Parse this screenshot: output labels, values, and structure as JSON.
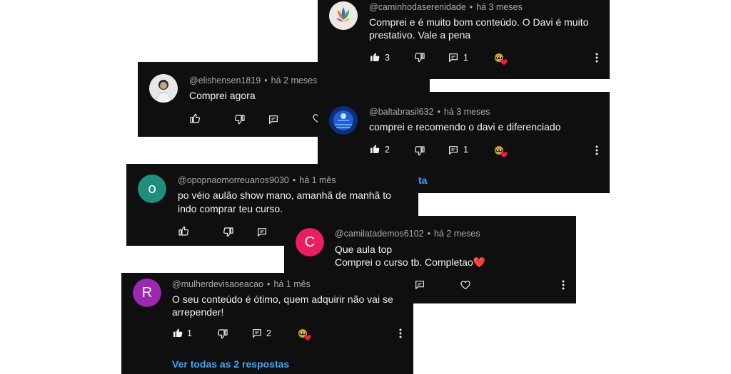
{
  "comments": [
    {
      "handle": "@caminhodaserenidade",
      "time": "há 3 meses",
      "line1": "Comprei e é muito bom conteúdo. O Davi é muito",
      "line2": "prestativo. Vale a pena",
      "likes": "3",
      "replies": "1"
    },
    {
      "handle": "@elishensen1819",
      "time": "há 2 meses",
      "line1": "Comprei agora"
    },
    {
      "handle": "@baltabrasil632",
      "time": "há 3 meses",
      "line1": "comprei e recomendo o davi e diferenciado",
      "likes": "2",
      "replies": "1",
      "partial_link": "ta"
    },
    {
      "handle": "@opopnaomorreuanos9030",
      "time": "há 1 mês",
      "line1": "po véio aulão show mano, amanhã de manhã to",
      "line2": "indo comprar teu curso.",
      "avatar_letter": "o",
      "avatar_color": "#1e8f7d"
    },
    {
      "handle": "@camilatademos6102",
      "time": "há 2 meses",
      "line1": "Que aula top",
      "line2": "Comprei o curso tb. Completao",
      "avatar_letter": "C",
      "avatar_color": "#e91e63",
      "heart": "❤️"
    },
    {
      "handle": "@mulherdevisaoeacao",
      "time": "há 1 mês",
      "line1": "O seu conteúdo é ótimo, quem adquirir não vai se",
      "line2": "arrepender!",
      "likes": "1",
      "replies": "2",
      "avatar_letter": "R",
      "avatar_color": "#9c27b0",
      "link": "Ver todas as 2 respostas"
    }
  ],
  "colors": {
    "card_bg": "#0f0f0f",
    "link": "#3ea6ff",
    "meta": "#aaaaaa",
    "text": "#f1f1f1"
  },
  "icons": [
    "thumb-up-icon",
    "thumb-down-icon",
    "reply-icon",
    "creator-heart-icon",
    "more-icon",
    "heart-outline-icon"
  ]
}
